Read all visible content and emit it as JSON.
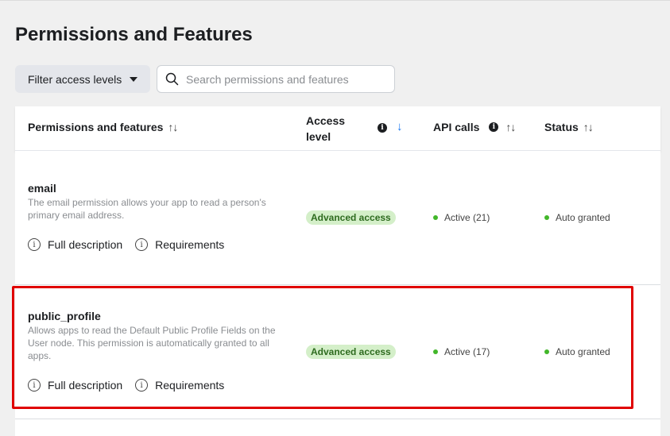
{
  "page": {
    "title": "Permissions and Features"
  },
  "filter": {
    "label": "Filter access levels"
  },
  "search": {
    "placeholder": "Search permissions and features"
  },
  "table": {
    "headers": {
      "permissions": "Permissions and features",
      "access_line1": "Access",
      "access_line2": "level",
      "api_calls": "API calls",
      "status": "Status"
    },
    "rows": [
      {
        "name": "email",
        "description": "The email permission allows your app to read a person's primary email address.",
        "full_description": "Full description",
        "requirements": "Requirements",
        "access": "Advanced access",
        "api_calls": "Active (21)",
        "status": "Auto granted"
      },
      {
        "name": "public_profile",
        "description": "Allows apps to read the Default Public Profile Fields on the User node. This permission is automatically granted to all apps.",
        "full_description": "Full description",
        "requirements": "Requirements",
        "access": "Advanced access",
        "api_calls": "Active (17)",
        "status": "Auto granted"
      }
    ]
  },
  "colors": {
    "highlight": "#e00000",
    "badge_bg": "#d4efc9",
    "status_dot": "#42b72a",
    "sort_active": "#1877f2"
  },
  "icons": [
    "search-icon",
    "info-icon",
    "sort-icon",
    "arrow-down-icon",
    "caret-down-icon"
  ]
}
